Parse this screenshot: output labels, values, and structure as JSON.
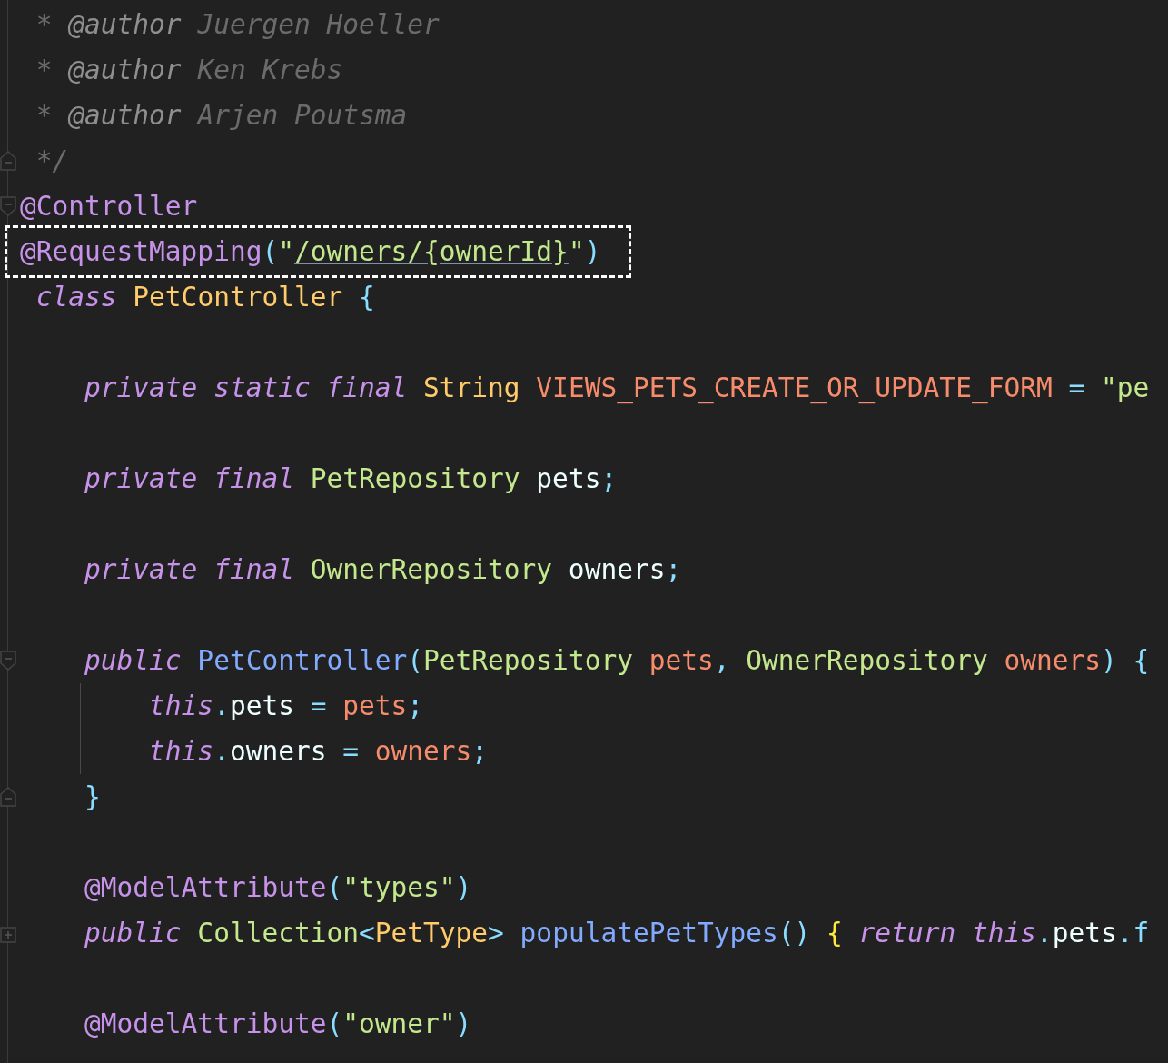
{
  "editor": {
    "lines": [
      {
        "highlighted": false,
        "tokens": [
          {
            "text": " * ",
            "kind": "comment"
          },
          {
            "text": "@author",
            "kind": "comment-tag"
          },
          {
            "text": " Juergen Hoeller",
            "kind": "comment"
          }
        ]
      },
      {
        "highlighted": false,
        "tokens": [
          {
            "text": " * ",
            "kind": "comment"
          },
          {
            "text": "@author",
            "kind": "comment-tag"
          },
          {
            "text": " Ken Krebs",
            "kind": "comment"
          }
        ]
      },
      {
        "highlighted": false,
        "tokens": [
          {
            "text": " * ",
            "kind": "comment"
          },
          {
            "text": "@author",
            "kind": "comment-tag"
          },
          {
            "text": " Arjen Poutsma",
            "kind": "comment"
          }
        ]
      },
      {
        "fold_marker": {
          "kind": "end"
        },
        "highlighted": false,
        "tokens": [
          {
            "text": " */",
            "kind": "comment"
          }
        ]
      },
      {
        "fold_marker": {
          "kind": "start"
        },
        "highlighted": false,
        "tokens": [
          {
            "text": "@Controller",
            "kind": "annotation"
          }
        ]
      },
      {
        "highlighted": true,
        "tokens": [
          {
            "text": "@RequestMapping",
            "kind": "annotation"
          },
          {
            "text": "(",
            "kind": "punct"
          },
          {
            "text": "\"",
            "kind": "string"
          },
          {
            "text": "/owners/{ownerId}",
            "kind": "string-link"
          },
          {
            "text": "\"",
            "kind": "string"
          },
          {
            "text": ")",
            "kind": "punct"
          }
        ]
      },
      {
        "highlighted": false,
        "tokens": [
          {
            "text": " class",
            "kind": "keyword"
          },
          {
            "text": " PetController",
            "kind": "class"
          },
          {
            "text": " {",
            "kind": "punct"
          }
        ]
      },
      {
        "gap_before": true,
        "highlighted": false,
        "tokens": [
          {
            "text": "    private static final",
            "kind": "keyword"
          },
          {
            "text": " String",
            "kind": "class"
          },
          {
            "text": " VIEWS_PETS_CREATE_OR_UPDATE_FORM",
            "kind": "constant"
          },
          {
            "text": " =",
            "kind": "punct"
          },
          {
            "text": " \"pe",
            "kind": "string"
          }
        ]
      },
      {
        "gap_before": true,
        "highlighted": false,
        "tokens": [
          {
            "text": "    private final",
            "kind": "keyword"
          },
          {
            "text": " PetRepository",
            "kind": "type"
          },
          {
            "text": " pets",
            "kind": "plain"
          },
          {
            "text": ";",
            "kind": "punct"
          }
        ]
      },
      {
        "gap_before": true,
        "highlighted": false,
        "tokens": [
          {
            "text": "    private final",
            "kind": "keyword"
          },
          {
            "text": " OwnerRepository",
            "kind": "type"
          },
          {
            "text": " owners",
            "kind": "plain"
          },
          {
            "text": ";",
            "kind": "punct"
          }
        ]
      },
      {
        "gap_before": true,
        "fold_marker": {
          "kind": "start"
        },
        "highlighted": false,
        "tokens": [
          {
            "text": "    public",
            "kind": "keyword"
          },
          {
            "text": " PetController",
            "kind": "function"
          },
          {
            "text": "(",
            "kind": "punct"
          },
          {
            "text": "PetRepository",
            "kind": "type"
          },
          {
            "text": " pets",
            "kind": "param"
          },
          {
            "text": ",",
            "kind": "punct"
          },
          {
            "text": " OwnerRepository",
            "kind": "type"
          },
          {
            "text": " owners",
            "kind": "param"
          },
          {
            "text": ")",
            "kind": "punct"
          },
          {
            "text": " {",
            "kind": "punct"
          }
        ]
      },
      {
        "highlighted": false,
        "tokens": [
          {
            "text": "        this",
            "kind": "keyword"
          },
          {
            "text": ".",
            "kind": "punct"
          },
          {
            "text": "pets",
            "kind": "plain"
          },
          {
            "text": " =",
            "kind": "punct"
          },
          {
            "text": " pets",
            "kind": "param"
          },
          {
            "text": ";",
            "kind": "punct"
          }
        ]
      },
      {
        "highlighted": false,
        "tokens": [
          {
            "text": "        this",
            "kind": "keyword"
          },
          {
            "text": ".",
            "kind": "punct"
          },
          {
            "text": "owners",
            "kind": "plain"
          },
          {
            "text": " =",
            "kind": "punct"
          },
          {
            "text": " owners",
            "kind": "param"
          },
          {
            "text": ";",
            "kind": "punct"
          }
        ]
      },
      {
        "fold_marker": {
          "kind": "end"
        },
        "highlighted": false,
        "tokens": [
          {
            "text": "    }",
            "kind": "punct"
          }
        ]
      },
      {
        "gap_before": true,
        "highlighted": false,
        "tokens": [
          {
            "text": "    @ModelAttribute",
            "kind": "annotation"
          },
          {
            "text": "(",
            "kind": "punct"
          },
          {
            "text": "\"types\"",
            "kind": "string"
          },
          {
            "text": ")",
            "kind": "punct"
          }
        ]
      },
      {
        "fold_marker": {
          "kind": "collapsed"
        },
        "highlighted": false,
        "tokens": [
          {
            "text": "    public",
            "kind": "keyword"
          },
          {
            "text": " Collection",
            "kind": "type"
          },
          {
            "text": "<",
            "kind": "punct"
          },
          {
            "text": "PetType",
            "kind": "class"
          },
          {
            "text": ">",
            "kind": "punct"
          },
          {
            "text": " populatePetTypes",
            "kind": "function"
          },
          {
            "text": "()",
            "kind": "punct"
          },
          {
            "text": " {",
            "kind": "brace"
          },
          {
            "text": " return this",
            "kind": "keyword"
          },
          {
            "text": ".",
            "kind": "punct"
          },
          {
            "text": "pets",
            "kind": "plain"
          },
          {
            "text": ".f",
            "kind": "punct"
          }
        ]
      },
      {
        "gap_before": true,
        "highlighted": false,
        "tokens": [
          {
            "text": "    @ModelAttribute",
            "kind": "annotation"
          },
          {
            "text": "(",
            "kind": "punct"
          },
          {
            "text": "\"owner\"",
            "kind": "string"
          },
          {
            "text": ")",
            "kind": "punct"
          }
        ]
      }
    ]
  }
}
